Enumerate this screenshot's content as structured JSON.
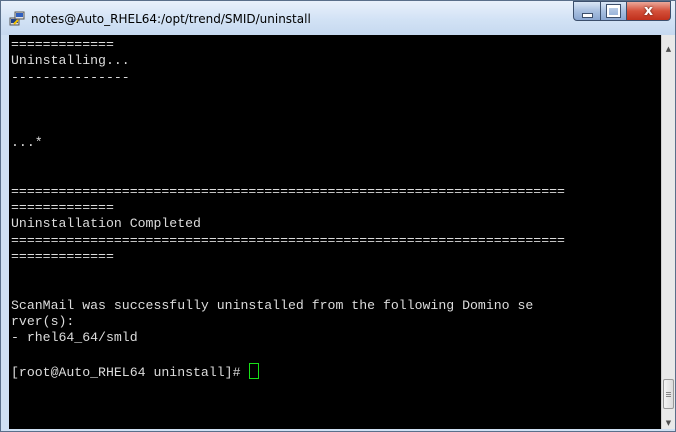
{
  "window": {
    "title": "notes@Auto_RHEL64:/opt/trend/SMID/uninstall",
    "close_glyph": "x"
  },
  "terminal": {
    "lines": [
      "=============",
      "Uninstalling...",
      "---------------",
      "",
      "",
      "",
      "...*",
      "",
      "",
      "======================================================================",
      "=============",
      "Uninstallation Completed",
      "======================================================================",
      "=============",
      "",
      "",
      "ScanMail was successfully uninstalled from the following Domino se",
      "rver(s):",
      "- rhel64_64/smld",
      "",
      "[root@Auto_RHEL64 uninstall]# "
    ],
    "text_color": "#dcdcdc",
    "background": "#000000",
    "cursor_color": "#18e018"
  },
  "icons": {
    "app": "putty-icon",
    "minimize": "minimize-icon",
    "maximize": "maximize-icon",
    "close": "close-icon",
    "scroll_up": "scroll-up-arrow-icon",
    "scroll_down": "scroll-down-arrow-icon"
  }
}
